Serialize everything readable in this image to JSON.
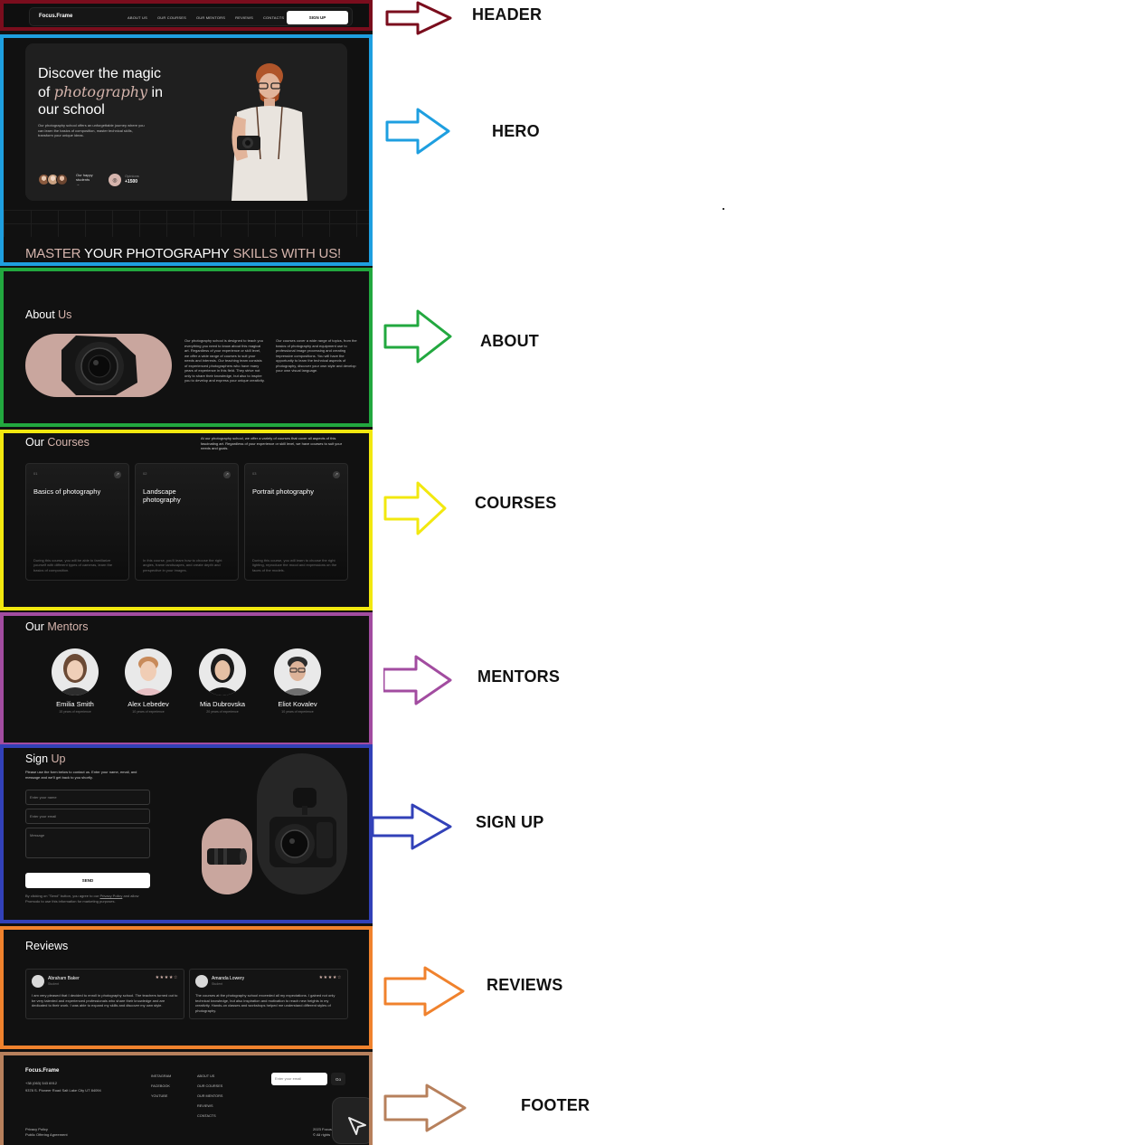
{
  "header": {
    "logo": "Focus.Frame",
    "nav": [
      "ABOUT US",
      "OUR COURSES",
      "OUR MENTORS",
      "REVIEWS",
      "CONTACTS"
    ],
    "signup": "SIGN UP"
  },
  "hero": {
    "title_1": "Discover the magic",
    "title_of": "of ",
    "title_em": "photography",
    "title_in": " in",
    "title_2": "our school",
    "desc": "Our photography school offers an unforgettable journey where you can learn the basics of composition, master technical skills, transform your unique ideas.",
    "happy_students": "Our happy students",
    "happy_arrow": "→",
    "opinions_label": "Opinions",
    "opinions_value": "+1500",
    "banner_1": "MASTER ",
    "banner_2": "YOUR PHOTOGRAPHY ",
    "banner_3": "SKILLS WITH US!"
  },
  "about": {
    "title_1": "About ",
    "title_2": "Us",
    "col1": "Our photography school is designed to teach you everything you need to know about this magical art. Regardless of your experience or skill level, we offer a wide range of courses to suit your needs and interests. Our teaching team consists of experienced photographers who have many years of experience in this field. They strive not only to share their knowledge, but also to inspire you to develop and express your unique creativity.",
    "col2": "Our courses cover a wide range of topics, from the basics of photography and equipment use to professional image processing and creating impressive compositions. You will have the opportunity to learn the technical aspects of photography, discover your own style and develop your own visual language."
  },
  "courses": {
    "title_1": "Our ",
    "title_2": "Courses",
    "intro": "At our photography school, we offer a variety of courses that cover all aspects of this fascinating art. Regardless of your experience or skill level, we have courses to suit your needs and goals.",
    "items": [
      {
        "num": "01",
        "title": "Basics of photography",
        "desc": "During this course, you will be able to familiarize yourself with different types of cameras, learn the basics of composition."
      },
      {
        "num": "02",
        "title": "Landscape photography",
        "desc": "In this course, you'll learn how to choose the right angles, frame landscapes, and create depth and perspective in your images."
      },
      {
        "num": "03",
        "title": "Portrait photography",
        "desc": "During this course, you will learn to choose the right lighting, reproduce the mood and expressions on the faces of the models."
      }
    ],
    "arrow": "↗"
  },
  "mentors": {
    "title_1": "Our ",
    "title_2": "Mentors",
    "items": [
      {
        "name": "Emilia Smith",
        "exp": "15 years of experience"
      },
      {
        "name": "Alex Lebedev",
        "exp": "10 years of experience"
      },
      {
        "name": "Mia Dubrovska",
        "exp": "20 years of experience"
      },
      {
        "name": "Eliot Kovalev",
        "exp": "10 years of experience"
      }
    ]
  },
  "signup": {
    "title_1": "Sign ",
    "title_2": "Up",
    "desc": "Please use the form below to contact us. Enter your name, email, and message and we'll get back to you shortly.",
    "name_placeholder": "Enter your name",
    "email_placeholder": "Enter your email",
    "message_placeholder": "Message",
    "send": "SEND",
    "note_1": "By clicking on \"Send\" button, you agree to our ",
    "note_link": "Privacy Policy",
    "note_2": "and allow Promodo to use this information for marketing purposes."
  },
  "reviews": {
    "title": "Reviews",
    "items": [
      {
        "name": "Abraham Baker",
        "role": "Student",
        "stars": "★★★★☆",
        "text": "I am very pleased that I decided to enroll in photography school. The teachers turned out to be very talented and experienced professionals who share their knowledge and are dedicated to their work. I was able to expand my skills and discover my own style."
      },
      {
        "name": "Amanda Lowery",
        "role": "Student",
        "stars": "★★★★☆",
        "text": "The courses at the photography school exceeded all my expectations. I gained not only technical knowledge, but also inspiration and motivation to reach new heights in my creativity. Hands-on classes and workshops helped me understand different styles of photography."
      }
    ]
  },
  "footer": {
    "logo": "Focus.Frame",
    "phone": "+38 (063) 543 6912",
    "address": "9378 S. Pioneer Road Salt Lake City UT 84094",
    "social": [
      "INSTAGRAM",
      "FACEBOOK",
      "YOUTUBE"
    ],
    "links": [
      "ABOUT US",
      "OUR COURSES",
      "OUR MENTORS",
      "REVIEWS",
      "CONTACTS"
    ],
    "email_placeholder": "Enter your email",
    "go": "Go",
    "privacy": "Privacy Policy",
    "offering": "Public Offering Agreement",
    "copyright_1": "2023 Focus",
    "copyright_2": "© All rights"
  },
  "annotations": {
    "header": "HEADER",
    "hero": "HERO",
    "about": "ABOUT",
    "courses": "COURSES",
    "mentors": "MENTORS",
    "signup": "SIGN UP",
    "reviews": "REVIEWS",
    "footer": "FOOTER"
  },
  "colors": {
    "header_frame": "#7a0d1d",
    "hero_frame": "#1e9fe0",
    "about_frame": "#22a83f",
    "courses_frame": "#f2e80f",
    "mentors_frame": "#a24ca0",
    "signup_frame": "#3241b8",
    "reviews_frame": "#f0822d",
    "footer_frame": "#b7805c",
    "accent": "#d6b5ad",
    "background": "#111111"
  }
}
